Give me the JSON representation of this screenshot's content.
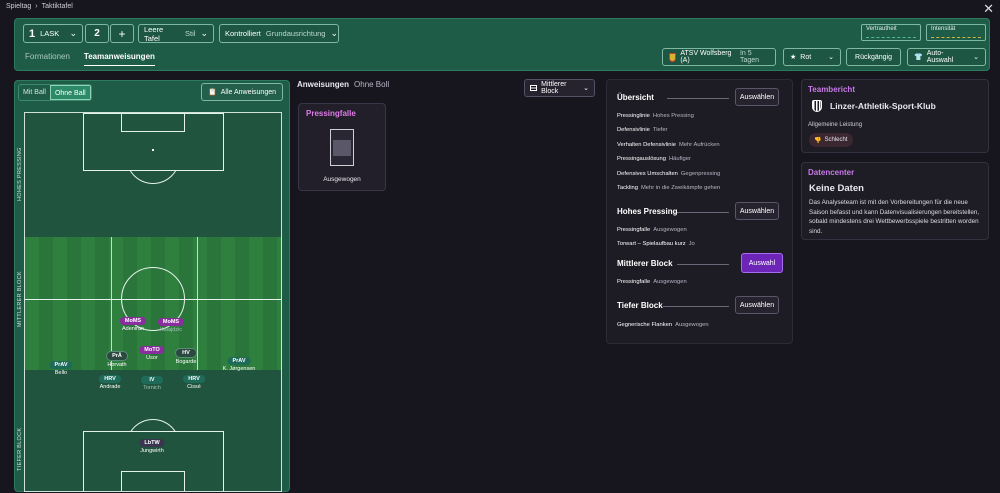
{
  "breadcrumb": {
    "root": "Spieltag",
    "current": "Taktiktafel"
  },
  "topbar": {
    "tactic_number": "1",
    "tactic_name": "LASK",
    "slot_two": "2",
    "add": "+",
    "fields": [
      {
        "label": "Leere Tafel",
        "value": "Stil"
      },
      {
        "label": "Kontrolliert",
        "value": "Grundausrichtung"
      }
    ],
    "meters": [
      {
        "label": "Vertrautheit"
      },
      {
        "label": "Intensität"
      }
    ],
    "tabs": [
      "Formationen",
      "Teamanweisungen"
    ],
    "active_tab": "Teamanweisungen",
    "next_match": {
      "opponent": "ATSV Wolfsberg (A)",
      "when": "In 5 Tagen"
    },
    "kit": "Rot",
    "undo": "Rückgängig",
    "auto": "Auto-Auswahl"
  },
  "pitch_panel": {
    "toggle": [
      "Mit Ball",
      "Ohne Ball"
    ],
    "toggle_active": "Ohne Ball",
    "all_instructions": "Alle Anweisungen",
    "zones": [
      "HOHES PRESSING",
      "MITTLERER BLOCK",
      "TIEFER BLOCK"
    ],
    "players": [
      {
        "pos": "MoMS",
        "name": "Adeniran",
        "style": "pu"
      },
      {
        "pos": "MoMS",
        "name": "Kalajdzic",
        "style": "pu",
        "dim": true
      },
      {
        "pos": "MoTO",
        "name": "Usor",
        "style": "pu"
      },
      {
        "pos": "PrÄ",
        "name": "Horvath",
        "style": "dk"
      },
      {
        "pos": "HV",
        "name": "Bogarde",
        "style": "dk"
      },
      {
        "pos": "PrAV",
        "name": "Bello",
        "style": "tl"
      },
      {
        "pos": "PrAV",
        "name": "K. Jørgensen",
        "style": "tl"
      },
      {
        "pos": "HRV",
        "name": "Andrade",
        "style": "tl"
      },
      {
        "pos": "IV",
        "name": "Tornich",
        "style": "tl",
        "dim": true
      },
      {
        "pos": "HRV",
        "name": "Cissé",
        "style": "tl"
      },
      {
        "pos": "LbTW",
        "name": "Jungwirth",
        "style": "gr"
      }
    ]
  },
  "instructions": {
    "title": "Anweisungen",
    "subtitle": "Ohne Boll",
    "card_title": "Pressingfalle",
    "card_value": "Ausgewogen",
    "block_select": "Mittlerer Block"
  },
  "overview": {
    "sections": [
      {
        "title": "Übersicht",
        "button": "Auswählen",
        "items": [
          {
            "k": "Pressinglinie",
            "v": "Hohes Pressing"
          },
          {
            "k": "Defensivlinie",
            "v": "Tiefer"
          },
          {
            "k": "Verhalten Defensivlinie",
            "v": "Mehr Aufrücken"
          },
          {
            "k": "Pressingauslösung",
            "v": "Häufiger"
          },
          {
            "k": "Defensives Umschalten",
            "v": "Gegenpressing"
          },
          {
            "k": "Tackling",
            "v": "Mehr in die Zweikämpfe gehen"
          }
        ]
      },
      {
        "title": "Hohes Pressing",
        "button": "Auswählen",
        "items": [
          {
            "k": "Pressingfalle",
            "v": "Ausgewogen"
          },
          {
            "k": "Torwart – Spielaufbau kurz",
            "v": "Jo"
          }
        ]
      },
      {
        "title": "Mittlerer Block",
        "button": "Auswahl",
        "active": true,
        "items": [
          {
            "k": "Pressingfalle",
            "v": "Ausgewogen"
          }
        ]
      },
      {
        "title": "Tiefer Block",
        "button": "Auswählen",
        "items": [
          {
            "k": "Gegnerische Flanken",
            "v": "Ausgewogen"
          }
        ]
      }
    ]
  },
  "team_report": {
    "header": "Teambericht",
    "club": "Linzer-Athletik-Sport-Klub",
    "perf_label": "Allgemeine Leistung",
    "perf_value": "Schlecht"
  },
  "data_center": {
    "header": "Datencenter",
    "title": "Keine Daten",
    "body": "Das Analyseteam ist mit den Vorbereitungen für die neue Saison befasst und kann Datenvisualisierungen bereitstellen, sobald mindestens drei Wettbewerbsspiele bestritten worden sind."
  },
  "colors": {
    "accent": "#6d25b8",
    "pitch": "#2f7f3e",
    "panel": "#1f5c47",
    "header_pink": "#c879e8"
  }
}
